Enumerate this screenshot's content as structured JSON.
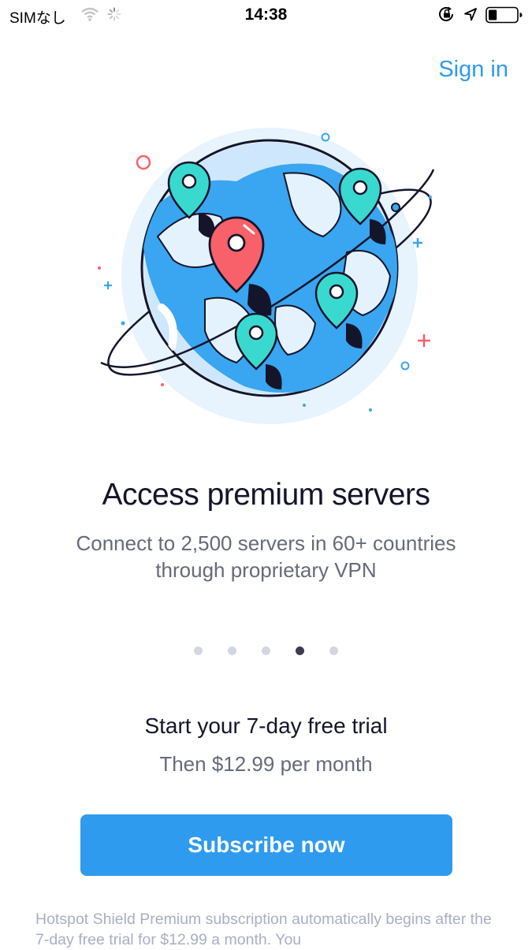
{
  "status_bar": {
    "carrier": "SIMなし",
    "time": "14:38",
    "icons": [
      "wifi-icon",
      "loading-spinner-icon",
      "orientation-lock-icon",
      "location-arrow-icon",
      "battery-icon"
    ],
    "battery_level": 0.3
  },
  "header": {
    "sign_in": "Sign in"
  },
  "illustration": {
    "name": "globe-with-location-pins-illustration"
  },
  "slide": {
    "title": "Access premium servers",
    "description": "Connect to 2,500 servers in 60+ countries through proprietary VPN"
  },
  "pager": {
    "total": 5,
    "active_index": 3
  },
  "trial": {
    "title": "Start your 7-day free trial",
    "price": "Then $12.99 per month"
  },
  "cta": {
    "subscribe": "Subscribe now"
  },
  "legal": "Hotspot Shield Premium subscription automatically begins after the 7-day free trial for $12.99 a month. You",
  "colors": {
    "accent": "#2e9bef",
    "title_text": "#14152b",
    "secondary_text": "#666a7a",
    "legal_text": "#a9aec4",
    "pin_teal": "#3ad9cf",
    "pin_red": "#f8616a",
    "globe_blue": "#3aa5f0"
  }
}
